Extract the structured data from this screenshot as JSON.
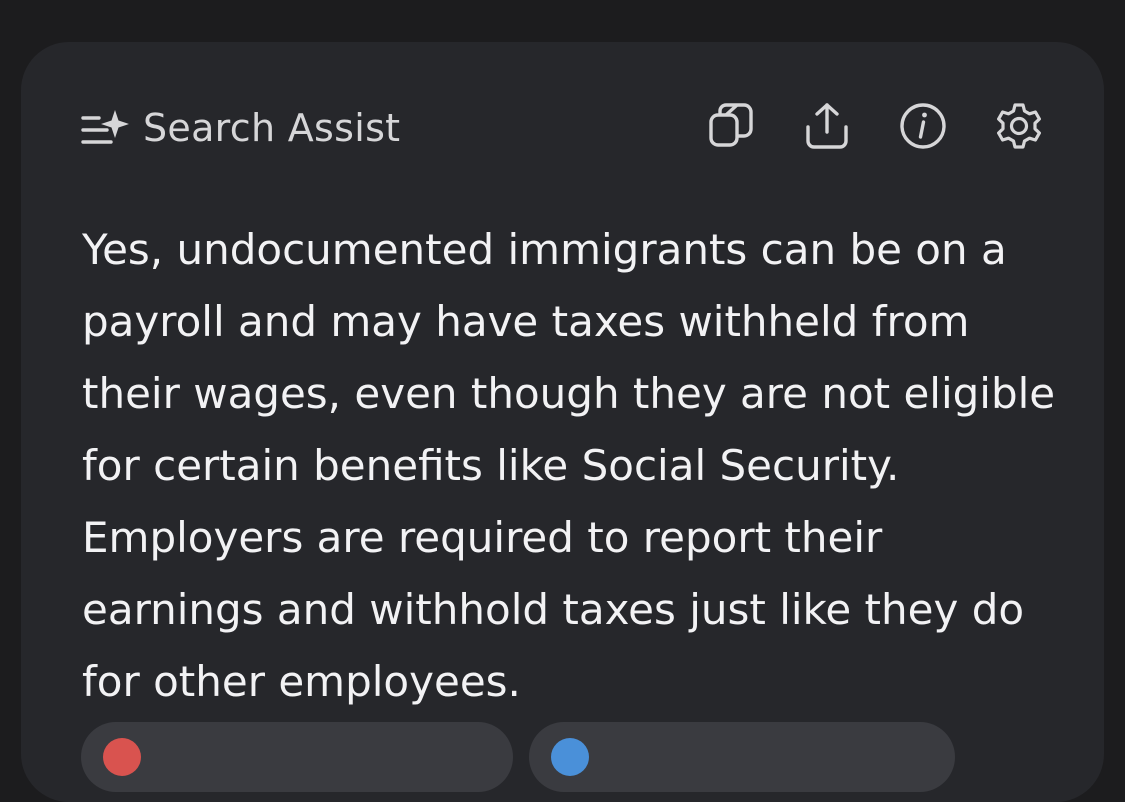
{
  "header": {
    "title": "Search Assist",
    "icon": "sparkle-lines-icon"
  },
  "actions": [
    {
      "name": "copy-icon"
    },
    {
      "name": "share-icon"
    },
    {
      "name": "info-icon"
    },
    {
      "name": "settings-icon"
    }
  ],
  "answer": {
    "text": "Yes, undocumented immigrants can be on a payroll and may have taxes withheld from their wages, even though they are not eligible for certain benefits like Social Security. Employers are required to report their earnings and withhold taxes just like they do for other employees."
  },
  "sources": [
    {
      "icon": "source-favicon",
      "color": "#d9534f"
    },
    {
      "icon": "source-favicon",
      "color": "#4a90d9"
    }
  ],
  "colors": {
    "background": "#1c1c1e",
    "card": "#26272b",
    "text": "#f2f2f4",
    "muted": "#d6d6d8",
    "chip": "#3a3b40"
  }
}
